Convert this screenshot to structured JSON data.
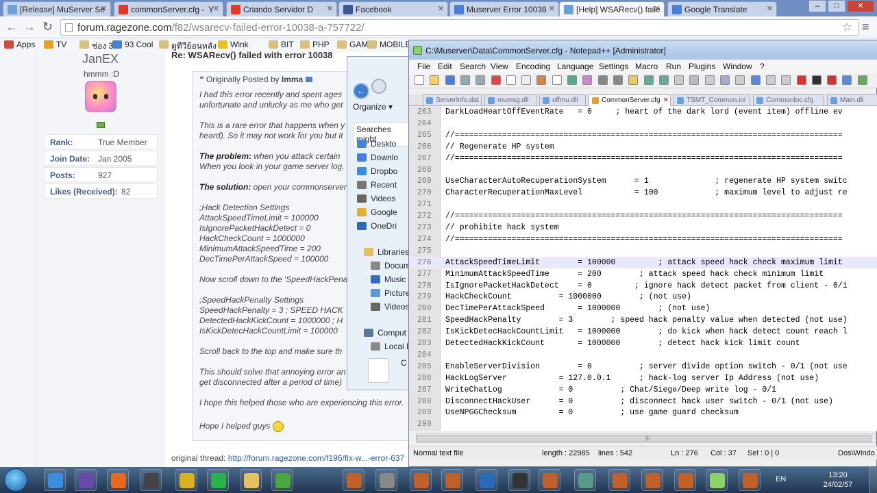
{
  "browser": {
    "tabs": [
      {
        "label": "[Release] MuServer Se",
        "color": "#6aa2d8"
      },
      {
        "label": "commonServer.cfg -  ‏Y",
        "color": "#e03a2e"
      },
      {
        "label": "Criando Servidor D",
        "color": "#e03a2e"
      },
      {
        "label": "Facebook",
        "color": "#3b5998"
      },
      {
        "label": "Muserver Error 10038",
        "color": "#4a7fd6"
      },
      {
        "label": "[Help] WSARecv() faile",
        "color": "#6aa2d8"
      },
      {
        "label": "Google Translate",
        "color": "#4a7fd6"
      }
    ],
    "url": "forum.ragezone.com",
    "url_path": "/f82/wsarecv-failed-error-10038-a-757722/",
    "bookmarks": [
      {
        "label": "Apps",
        "color": "#d64a3a"
      },
      {
        "label": "TV",
        "color": "#e8a020"
      },
      {
        "label": "ช่อง 3",
        "color": "#d8c080"
      },
      {
        "label": "93 Cool",
        "color": "#4a7fd6"
      },
      {
        "label": "ดูทีวีย้อนหลัง",
        "color": "#d8c080"
      },
      {
        "label": "Wink",
        "color": "#e8c020"
      },
      {
        "label": "BIT",
        "color": "#d8c080"
      },
      {
        "label": "PHP",
        "color": "#d8c080"
      },
      {
        "label": "GAME",
        "color": "#d8c080"
      },
      {
        "label": "MOBILE",
        "color": "#d8c080"
      }
    ]
  },
  "forum": {
    "username": "JanEX",
    "user_title": "hmmm :D",
    "stats": [
      {
        "key": "Rank:",
        "value": "True Member"
      },
      {
        "key": "Join Date:",
        "value": "Jan 2005"
      },
      {
        "key": "Posts:",
        "value": "927"
      },
      {
        "key": "Likes (Received):",
        "value": "82"
      }
    ],
    "post_title": "Re: WSARecv() failed with error 10038",
    "quote_head": "Originally Posted by",
    "quote_author": "Imma",
    "lines": [
      "I had this error recently and spent ages",
      "unfortunate and unlucky as me who get",
      "This is a rare error that happens when y",
      "heard). So it may not work for you but it",
      "when you attack certain",
      "When you look in your game server log,",
      "open your commonserver",
      ";Hack Detection Settings",
      "AttackSpeedTimeLimit = 100000",
      "IsIgnorePacketHackDetect = 0",
      "HackCheckCount = 1000000",
      "MinimumAttackSpeedTime = 200",
      "DecTimePerAttackSpeed = 100000",
      "Now scroll down to the 'SpeedHackPena",
      ";SpeedHackPenalty Settings",
      "SpeedHackPenalty = 3 ; SPEED HACK",
      "DetectedHackKickCount = 1000000 ; H",
      "IsKickDetecHackCountLimit = 100000",
      "Scroll back to the top and make sure th",
      "This should solve that annoying error an",
      "get disconnected after a period of time)",
      "I hope this helped those who are experiencing this error.",
      "Hope I helped guys"
    ],
    "problem_label": "The problem:",
    "solution_label": "The solution:",
    "orig_label": "original thread:",
    "orig_link": "http://forum.ragezone.com/f196/fix-w...-error-637"
  },
  "explorer": {
    "organize": "Organize",
    "searches": "Searches might",
    "items": [
      {
        "label": "Deskto",
        "color": "#4a7fd6"
      },
      {
        "label": "Downlo",
        "color": "#4a7fd6"
      },
      {
        "label": "Dropbo",
        "color": "#3a8ee0"
      },
      {
        "label": "Recent",
        "color": "#777"
      },
      {
        "label": "Videos",
        "color": "#666"
      },
      {
        "label": "Google",
        "color": "#e0b030"
      },
      {
        "label": "OneDri",
        "color": "#2a6ab8"
      },
      {
        "label": "Libraries",
        "color": "#e0c060"
      },
      {
        "label": "Docum",
        "color": "#888"
      },
      {
        "label": "Music",
        "color": "#3a6ab8"
      },
      {
        "label": "Picture",
        "color": "#5a9ad8"
      },
      {
        "label": "Videos",
        "color": "#666"
      },
      {
        "label": "Comput",
        "color": "#5a7a9a"
      },
      {
        "label": "Local D",
        "color": "#888"
      }
    ],
    "file_label": "C"
  },
  "npp": {
    "title": "C:\\Muserver\\Data\\CommonServer.cfg - Notepad++ [Administrator]",
    "menu": [
      "File",
      "Edit",
      "Search",
      "View",
      "Encoding",
      "Language",
      "Settings",
      "Macro",
      "Run",
      "Plugins",
      "Window",
      "?"
    ],
    "tabs": [
      "ServerInfo.dat",
      "mumsg.dll",
      "offmu.dll",
      "CommonServer.cfg",
      "TSMT_Common.ini",
      "Commonloc.cfg",
      "Main.dll"
    ],
    "lines": [
      {
        "n": "263",
        "t": "DarkLoadHeartOffEventRate   = 0     ; heart of the dark lord (event item) offline ev"
      },
      {
        "n": "264",
        "t": ""
      },
      {
        "n": "265",
        "t": "//=================================================================================="
      },
      {
        "n": "266",
        "t": "// Regenerate HP system"
      },
      {
        "n": "267",
        "t": "//=================================================================================="
      },
      {
        "n": "268",
        "t": ""
      },
      {
        "n": "269",
        "t": "UseCharacterAutoRecuperationSystem      = 1              ; regenerate HP system switc"
      },
      {
        "n": "270",
        "t": "CharacterRecuperationMaxLevel           = 100            ; maximum level to adjust re"
      },
      {
        "n": "271",
        "t": ""
      },
      {
        "n": "272",
        "t": "//=================================================================================="
      },
      {
        "n": "273",
        "t": "// prohibite hack system"
      },
      {
        "n": "274",
        "t": "//=================================================================================="
      },
      {
        "n": "275",
        "t": ""
      },
      {
        "n": "276",
        "t": "AttackSpeedTimeLimit        = 100000         ; attack speed hack check maximum limit"
      },
      {
        "n": "277",
        "t": "MinimumAttackSpeedTime      = 200        ; attack speed hack check minimum limit"
      },
      {
        "n": "278",
        "t": "IsIgnorePacketHackDetect    = 0         ; ignore hack detect packet from client - 0/1"
      },
      {
        "n": "279",
        "t": "HackCheckCount          = 1000000        ; (not use)"
      },
      {
        "n": "280",
        "t": "DecTimePerAttackSpeed       = 1000000        ; (not use)"
      },
      {
        "n": "281",
        "t": "SpeedHackPenalty        = 3        ; speed hack penalty value when detected (not use)"
      },
      {
        "n": "282",
        "t": "IsKickDetecHackCountLimit   = 1000000        ; do kick when hack detect count reach l"
      },
      {
        "n": "283",
        "t": "DetectedHackKickCount       = 1000000        ; detect hack kick limit count"
      },
      {
        "n": "284",
        "t": ""
      },
      {
        "n": "285",
        "t": "EnableServerDivision        = 0          ; server divide option switch - 0/1 (not use"
      },
      {
        "n": "286",
        "t": "HackLogServer           = 127.0.0.1      ; hack-log server Ip Address (not use)"
      },
      {
        "n": "287",
        "t": "WriteChatLog            = 0          ; Chat/Siege/Deep write log - 0/1"
      },
      {
        "n": "288",
        "t": "DisconnectHackUser      = 0          ; disconnect hack user switch - 0/1 (not use)"
      },
      {
        "n": "289",
        "t": "UseNPGGChecksum         = 0          ; use game guard checksum"
      },
      {
        "n": "290",
        "t": ""
      }
    ],
    "current_line_index": 13,
    "status": {
      "type": "Normal text file",
      "length": "length : 22985",
      "lines": "lines : 542",
      "ln": "Ln : 276",
      "col": "Col : 37",
      "sel": "Sel : 0 | 0",
      "eol": "Dos\\Windo"
    }
  },
  "taskbar": {
    "lang": "EN",
    "time": "13:20",
    "date": "24/02/57",
    "apps": [
      {
        "name": "ie-icon",
        "color": "#3a8ee0"
      },
      {
        "name": "visual-studio-icon",
        "color": "#6a4aa8"
      },
      {
        "name": "firefox-icon",
        "color": "#e86a20"
      },
      {
        "name": "media-player-icon",
        "color": "#444"
      },
      {
        "name": "chrome-icon",
        "color": "#d8b020"
      },
      {
        "name": "line-icon",
        "color": "#2ab24a"
      },
      {
        "name": "explorer-icon",
        "color": "#e8c060"
      },
      {
        "name": "utorrent-icon",
        "color": "#4aa83a"
      },
      {
        "name": "mu-icon-1",
        "color": "#c0602a"
      },
      {
        "name": "server-icon",
        "color": "#888"
      },
      {
        "name": "mu-icon-2",
        "color": "#c0602a"
      },
      {
        "name": "mu-icon-3",
        "color": "#c0602a"
      },
      {
        "name": "app-icon",
        "color": "#2a6ab8"
      },
      {
        "name": "excel-icon",
        "color": "#333"
      },
      {
        "name": "mu-icon-4",
        "color": "#c0602a"
      },
      {
        "name": "dragon-icon",
        "color": "#5a9a8a"
      },
      {
        "name": "mu-icon-5",
        "color": "#c0602a"
      },
      {
        "name": "mu-icon-6",
        "color": "#c0602a"
      },
      {
        "name": "mu-icon-7",
        "color": "#c0602a"
      },
      {
        "name": "notepadpp-icon",
        "color": "#8fd06a"
      },
      {
        "name": "mu-icon-8",
        "color": "#c0602a"
      }
    ]
  }
}
